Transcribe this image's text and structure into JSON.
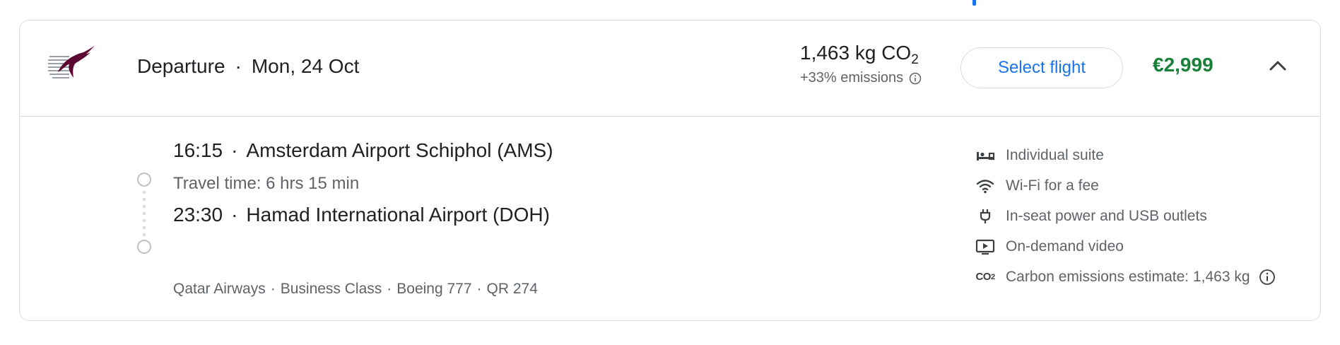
{
  "header": {
    "label": "Departure",
    "date": "Mon, 24 Oct",
    "co2_value": "1,463 kg CO",
    "co2_sub": "2",
    "emissions_delta": "+33% emissions",
    "select_label": "Select flight",
    "price": "€2,999"
  },
  "leg": {
    "departure_time": "16:15",
    "departure_airport": "Amsterdam Airport Schiphol (AMS)",
    "travel_time": "Travel time: 6 hrs 15 min",
    "arrival_time": "23:30",
    "arrival_airport": "Hamad International Airport (DOH)"
  },
  "meta": {
    "airline": "Qatar Airways",
    "cabin": "Business Class",
    "aircraft": "Boeing 777",
    "flight_no": "QR 274"
  },
  "amenities": {
    "suite": "Individual suite",
    "wifi": "Wi-Fi for a fee",
    "power": "In-seat power and USB outlets",
    "video": "On-demand video",
    "carbon": "Carbon emissions estimate: 1,463 kg"
  },
  "icons": {
    "co2_icon_text": "CO",
    "co2_icon_sub": "2"
  },
  "colors": {
    "accent": "#1a73e8",
    "price": "#188038",
    "airline_logo": "#5c0632"
  }
}
